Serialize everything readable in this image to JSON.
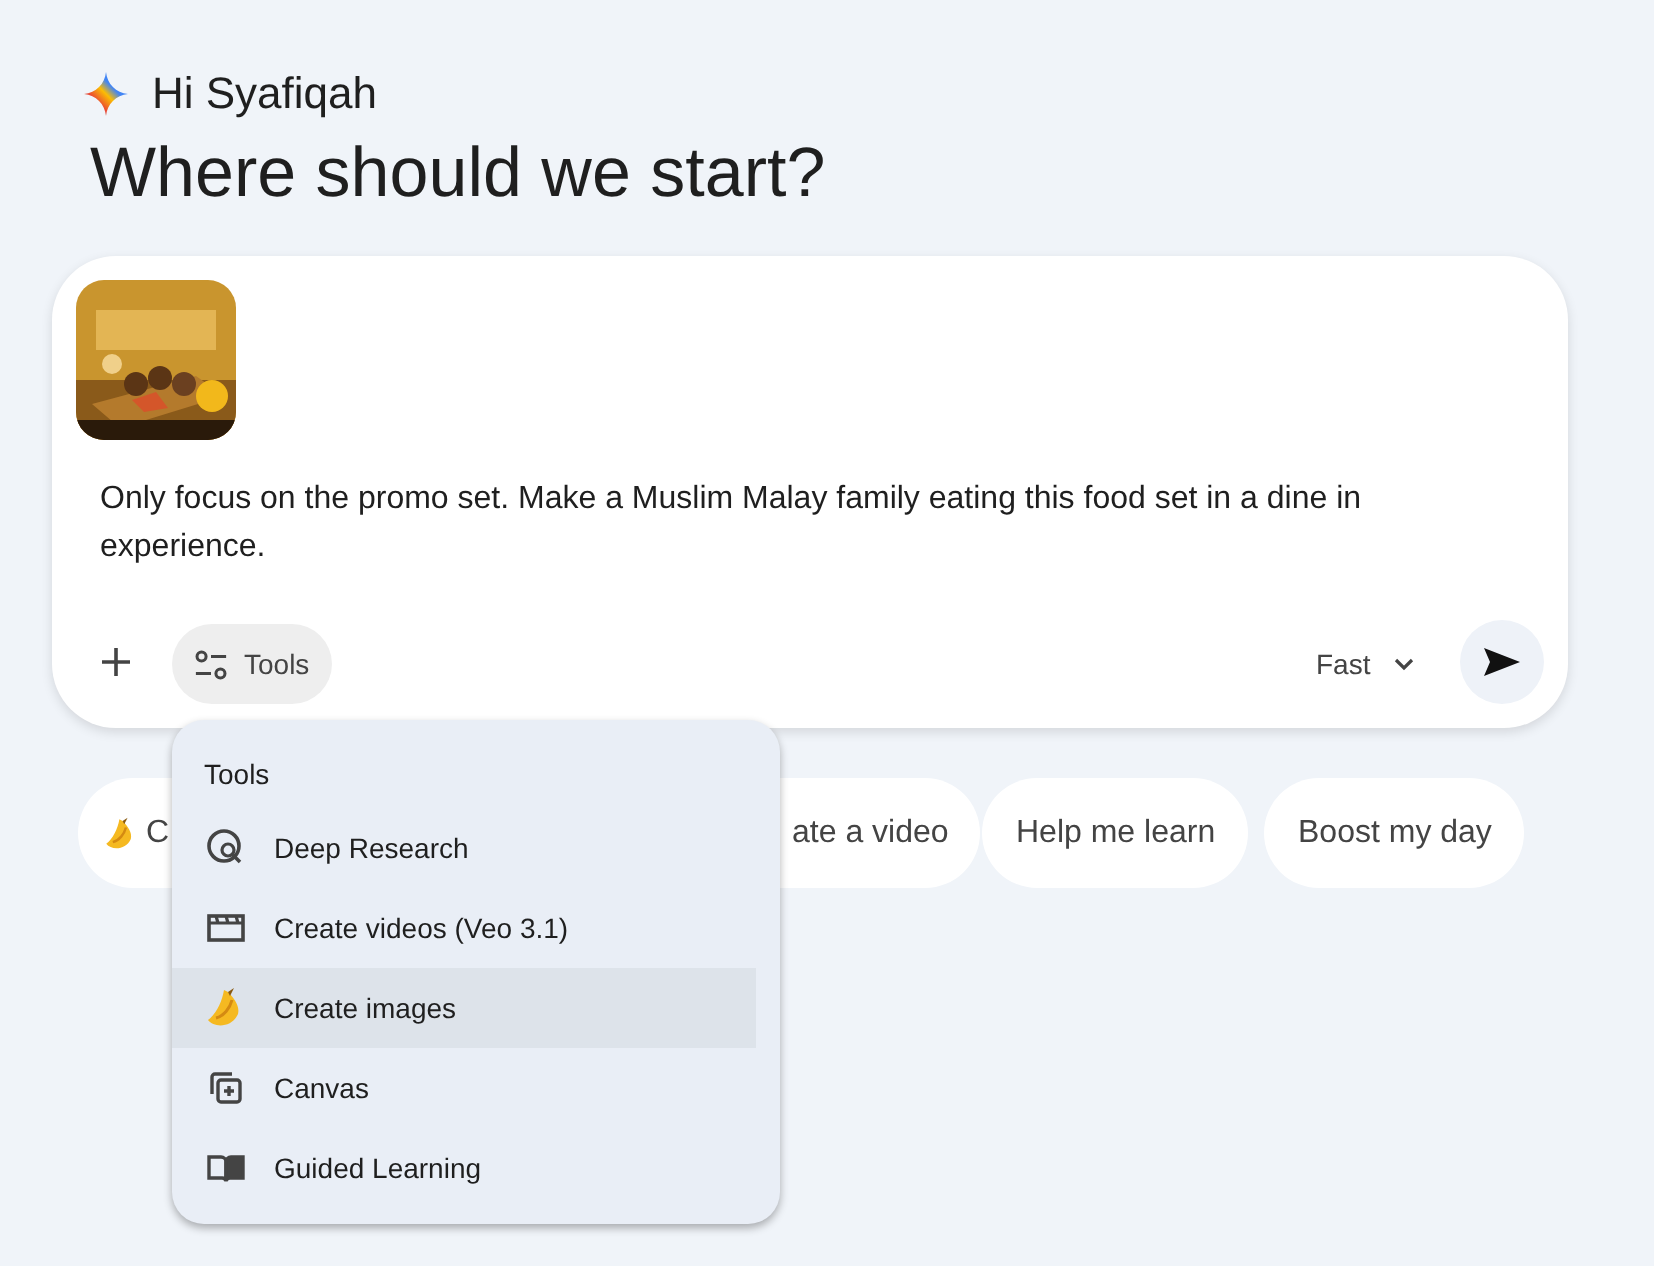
{
  "greeting": "Hi Syafiqah",
  "heading": "Where should we start?",
  "prompt": {
    "text": "Only focus on the promo set. Make a Muslim Malay family eating this food set in a dine in experience."
  },
  "toolbar": {
    "tools_label": "Tools",
    "model": "Fast"
  },
  "tools_menu": {
    "title": "Tools",
    "items": [
      {
        "label": "Deep Research",
        "selected": false
      },
      {
        "label": "Create videos (Veo 3.1)",
        "selected": false
      },
      {
        "label": "Create images",
        "selected": true
      },
      {
        "label": "Canvas",
        "selected": false
      },
      {
        "label": "Guided Learning",
        "selected": false
      }
    ]
  },
  "chips": [
    {
      "label": "C"
    },
    {
      "label": "ate a video"
    },
    {
      "label": "Help me learn"
    },
    {
      "label": "Boost my day"
    }
  ]
}
